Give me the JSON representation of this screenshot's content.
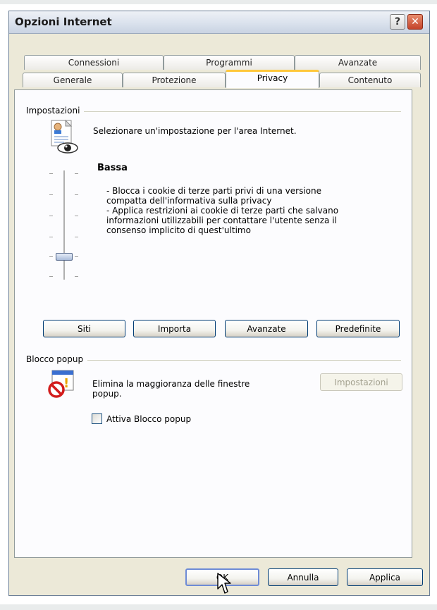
{
  "window": {
    "title": "Opzioni Internet",
    "help_symbol": "?",
    "close_symbol": "✕"
  },
  "tabs": {
    "row1": [
      "Connessioni",
      "Programmi",
      "Avanzate"
    ],
    "row2": [
      "Generale",
      "Protezione",
      "Privacy",
      "Contenuto"
    ],
    "active": "Privacy"
  },
  "settings": {
    "group_label": "Impostazioni",
    "intro": "Selezionare un'impostazione per l'area Internet.",
    "level_title": "Bassa",
    "level_desc": [
      "- Blocca i cookie di terze parti privi di una versione",
      "compatta dell'informativa sulla privacy",
      "- Applica restrizioni ai cookie di terze parti che salvano",
      "informazioni utilizzabili per contattare l'utente senza il",
      "consenso implicito di quest'ultimo"
    ],
    "slider_level": 2,
    "slider_levels_total": 6,
    "buttons": [
      "Siti",
      "Importa",
      "Avanzate",
      "Predefinite"
    ]
  },
  "popup": {
    "group_label": "Blocco popup",
    "desc_line1": "Elimina la maggioranza delle finestre",
    "desc_line2": "popup.",
    "settings_button": "Impostazioni",
    "checkbox_label": "Attiva Blocco popup",
    "checkbox_checked": false
  },
  "footer": {
    "ok": "OK",
    "cancel": "Annulla",
    "apply": "Applica"
  },
  "colors": {
    "active_tab_accent": "#ffc83c",
    "close_button": "#c4432a",
    "button_border": "#003c74"
  }
}
